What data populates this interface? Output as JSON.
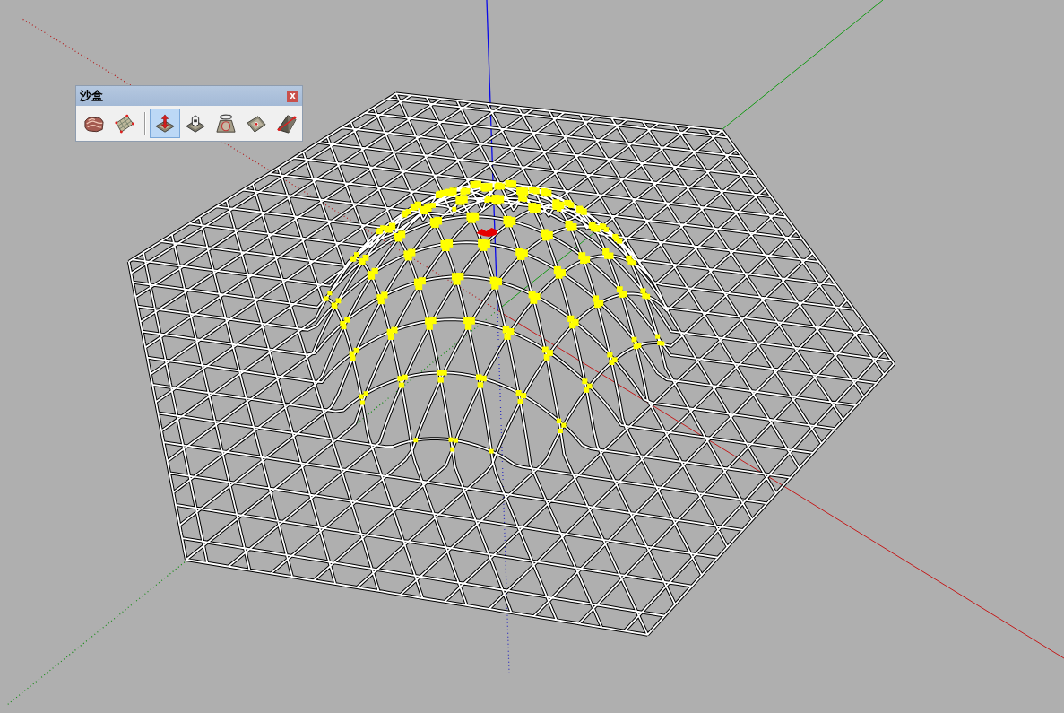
{
  "toolbar": {
    "title": "沙盒",
    "close_label": "x",
    "groups": [
      {
        "tools": [
          {
            "kind": "waves",
            "selected": false
          },
          {
            "kind": "grid",
            "selected": false
          }
        ]
      },
      {
        "tools": [
          {
            "kind": "arrow",
            "selected": true
          },
          {
            "kind": "box",
            "selected": false
          },
          {
            "kind": "ring",
            "selected": false
          },
          {
            "kind": "dot",
            "selected": false
          },
          {
            "kind": "pyramid",
            "selected": false
          }
        ]
      }
    ]
  },
  "viewport": {
    "dome_selected": true
  }
}
